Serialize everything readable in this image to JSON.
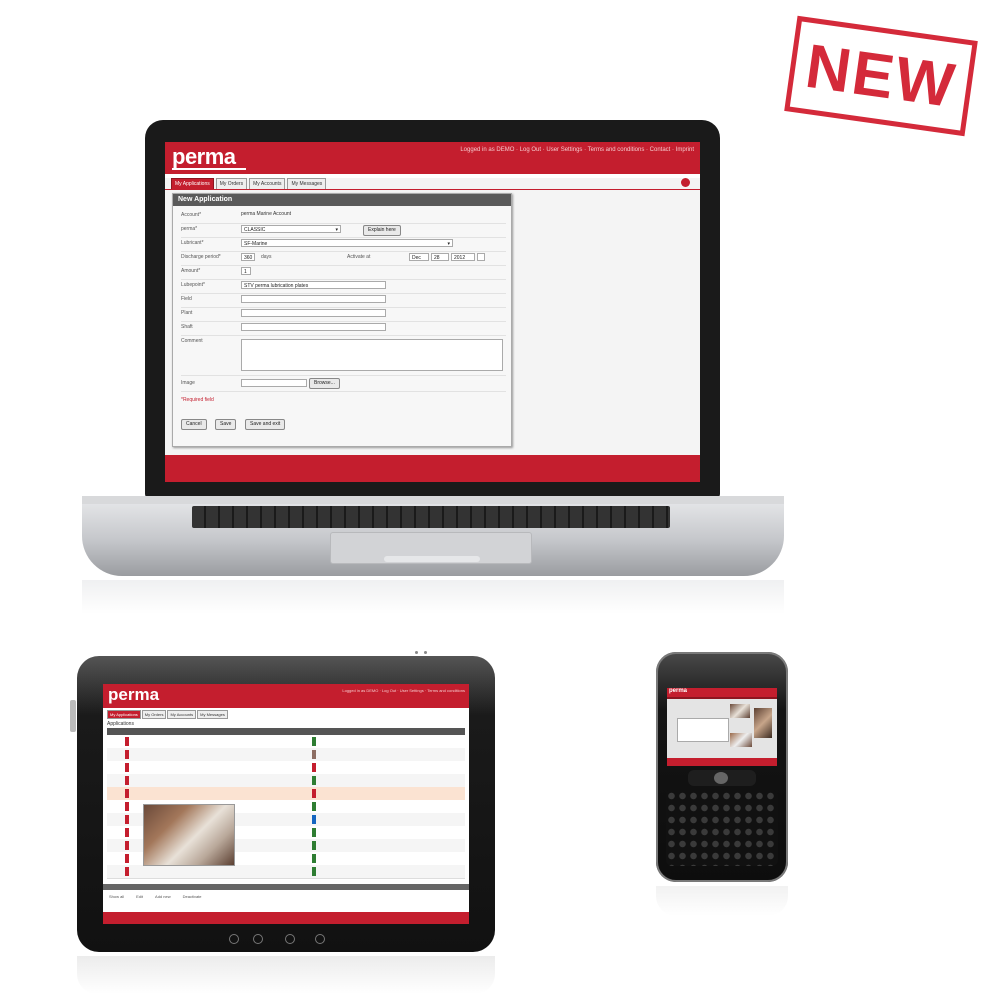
{
  "badge": {
    "text": "NEW"
  },
  "laptop": {
    "logo": "perma",
    "top_links": "Logged in as DEMO · Log Out · User Settings · Terms and conditions · Contact · Imprint",
    "tabs": [
      "My Applications",
      "My Orders",
      "My Accounts",
      "My Messages"
    ],
    "panel_title": "New Application",
    "form": {
      "account_label": "Account*",
      "account_value": "perma Marine Account",
      "perma_label": "perma*",
      "perma_value": "CLASSIC",
      "perma_button": "Explain here",
      "lubricant_label": "Lubricant*",
      "lubricant_value": "SF-Marine",
      "discharge_label": "Discharge period*",
      "discharge_value": "360",
      "discharge_unit": "days",
      "activate_label": "Activate at",
      "date_month": "Dec",
      "date_day": "28",
      "date_year": "2012",
      "amount_label": "Amount*",
      "amount_value": "1",
      "lubpoint_label": "Lubepoint*",
      "lubpoint_value": "STV perma lubrication plates",
      "field1_label": "Field",
      "field2_label": "Plant",
      "field3_label": "Shaft",
      "comment_label": "Comment",
      "image_label": "Image",
      "browse_button": "Browse...",
      "required_note": "*Required field",
      "cancel_button": "Cancel",
      "save_button": "Save",
      "save_exit_button": "Save and exit"
    }
  },
  "tablet": {
    "logo": "perma",
    "top_links": "Logged in as DEMO · Log Out · User Settings · Terms and conditions",
    "tabs": [
      "My Applications",
      "My Orders",
      "My Accounts",
      "My Messages"
    ],
    "list_title": "Applications",
    "footer_links": [
      "Show all",
      "Edit",
      "Add new",
      "Deactivate"
    ]
  },
  "phone": {
    "logo": "perma"
  },
  "colors": {
    "brand_red": "#c41e2e",
    "stamp_red": "#d42a3a"
  }
}
